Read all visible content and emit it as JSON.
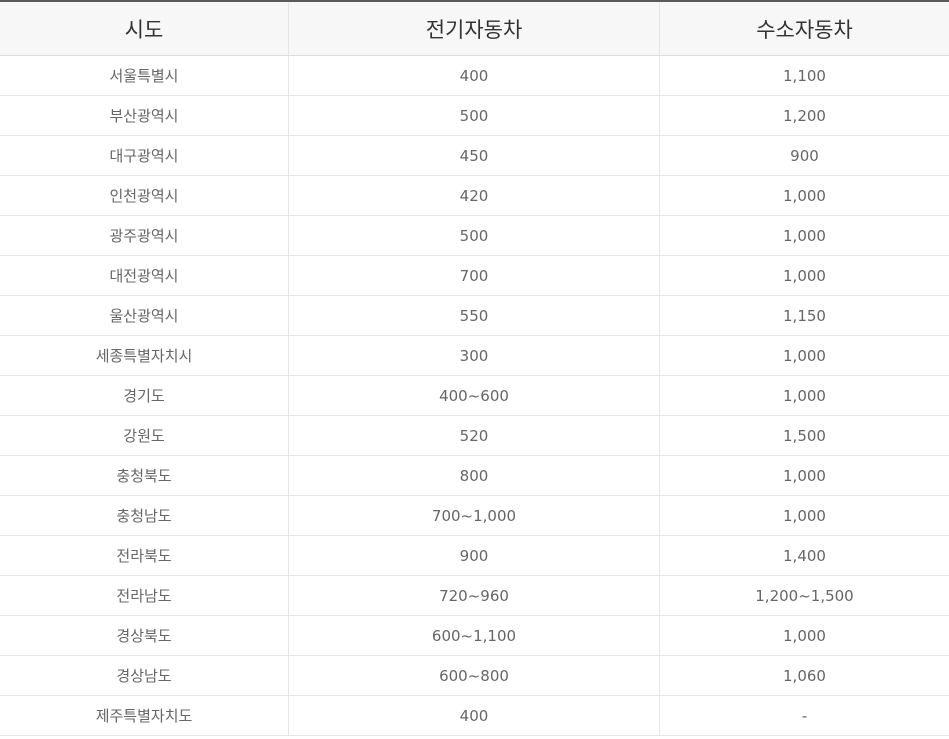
{
  "table": {
    "headers": [
      "시도",
      "전기자동차",
      "수소자동차"
    ],
    "rows": [
      [
        "서울특별시",
        "400",
        "1,100"
      ],
      [
        "부산광역시",
        "500",
        "1,200"
      ],
      [
        "대구광역시",
        "450",
        "900"
      ],
      [
        "인천광역시",
        "420",
        "1,000"
      ],
      [
        "광주광역시",
        "500",
        "1,000"
      ],
      [
        "대전광역시",
        "700",
        "1,000"
      ],
      [
        "울산광역시",
        "550",
        "1,150"
      ],
      [
        "세종특별자치시",
        "300",
        "1,000"
      ],
      [
        "경기도",
        "400~600",
        "1,000"
      ],
      [
        "강원도",
        "520",
        "1,500"
      ],
      [
        "충청북도",
        "800",
        "1,000"
      ],
      [
        "충청남도",
        "700~1,000",
        "1,000"
      ],
      [
        "전라북도",
        "900",
        "1,400"
      ],
      [
        "전라남도",
        "720~960",
        "1,200~1,500"
      ],
      [
        "경상북도",
        "600~1,100",
        "1,000"
      ],
      [
        "경상남도",
        "600~800",
        "1,060"
      ],
      [
        "제주특별자치도",
        "400",
        "-"
      ]
    ]
  }
}
